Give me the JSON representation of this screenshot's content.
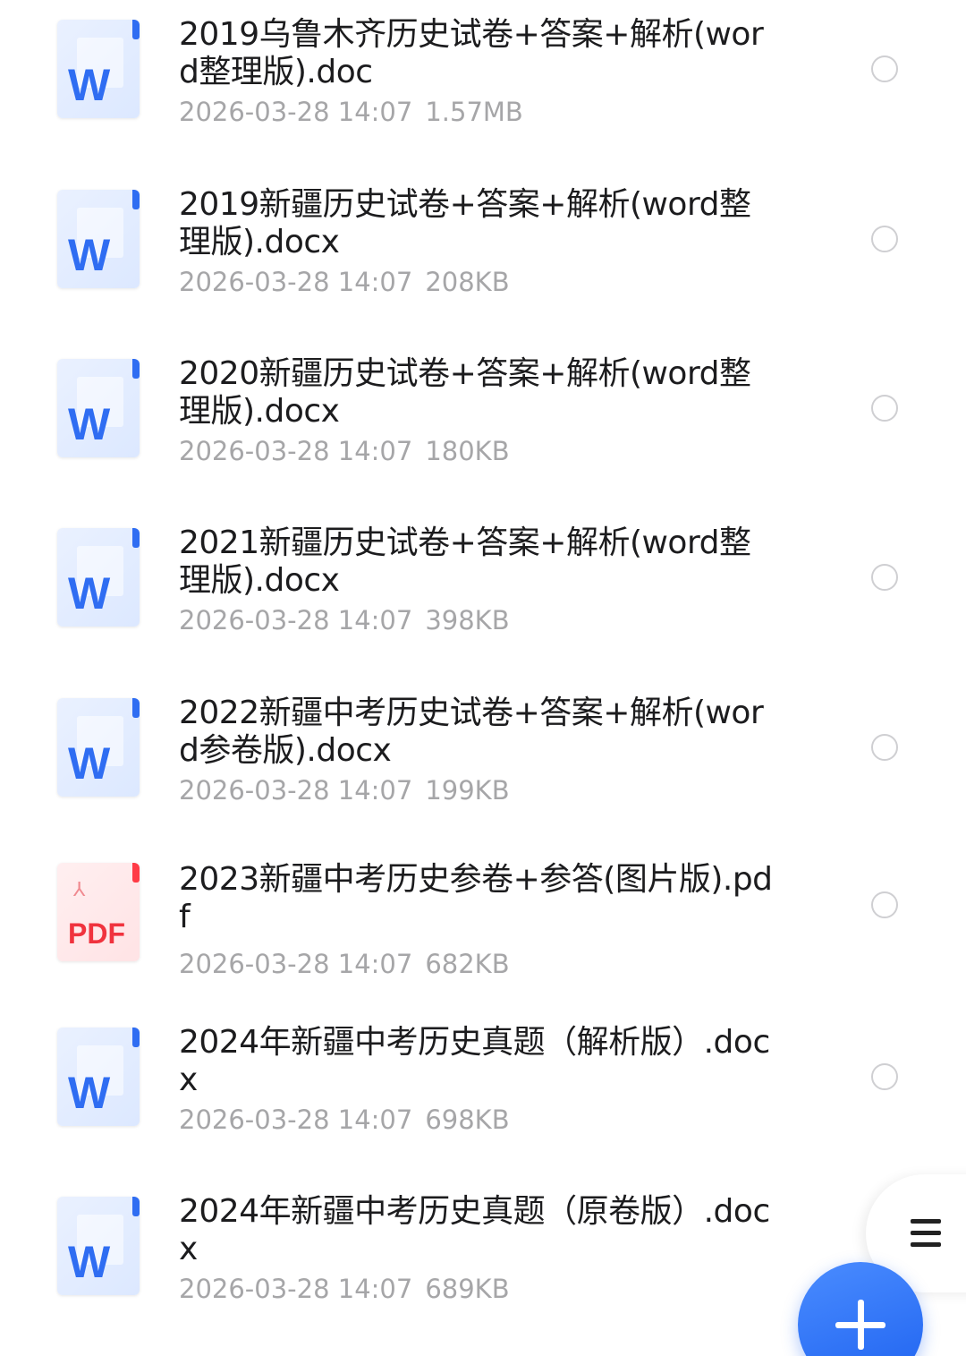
{
  "files": [
    {
      "icon": "word-doc-icon",
      "icon_label": "W",
      "name": "2019乌鲁木齐历史试卷+答案+解析(word整理版).doc",
      "date": "2026-03-28 14:07",
      "size": "1.57MB"
    },
    {
      "icon": "word-doc-icon",
      "icon_label": "W",
      "name": "2019新疆历史试卷+答案+解析(word整理版).docx",
      "date": "2026-03-28 14:07",
      "size": "208KB"
    },
    {
      "icon": "word-doc-icon",
      "icon_label": "W",
      "name": "2020新疆历史试卷+答案+解析(word整理版).docx",
      "date": "2026-03-28 14:07",
      "size": "180KB"
    },
    {
      "icon": "word-doc-icon",
      "icon_label": "W",
      "name": "2021新疆历史试卷+答案+解析(word整理版).docx",
      "date": "2026-03-28 14:07",
      "size": "398KB"
    },
    {
      "icon": "word-doc-icon",
      "icon_label": "W",
      "name": "2022新疆中考历史试卷+答案+解析(word参卷版).docx",
      "date": "2026-03-28 14:07",
      "size": "199KB"
    },
    {
      "icon": "pdf-icon",
      "icon_label": "PDF",
      "name": "2023新疆中考历史参卷+参答(图片版).pdf",
      "date": "2026-03-28 14:07",
      "size": "682KB"
    },
    {
      "icon": "word-doc-icon",
      "icon_label": "W",
      "name": "2024年新疆中考历史真题（解析版）.docx",
      "date": "2026-03-28 14:07",
      "size": "698KB"
    },
    {
      "icon": "word-doc-icon",
      "icon_label": "W",
      "name": "2024年新疆中考历史真题（原卷版）.docx",
      "date": "2026-03-28 14:07",
      "size": "689KB"
    }
  ],
  "controls": {
    "menu_icon": "hamburger-menu-icon",
    "fab_icon": "plus-icon"
  },
  "colors": {
    "accent": "#2f6df2",
    "pdf": "#f0333e",
    "meta_text": "#a6a6a8"
  }
}
